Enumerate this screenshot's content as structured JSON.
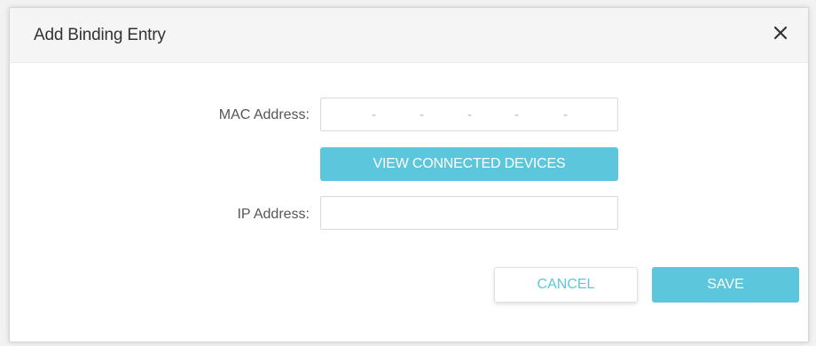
{
  "dialog": {
    "title": "Add Binding Entry",
    "close_icon": "close-icon"
  },
  "form": {
    "mac_label": "MAC Address:",
    "mac_separators": [
      "-",
      "-",
      "-",
      "-",
      "-"
    ],
    "view_devices_label": "VIEW CONNECTED DEVICES",
    "ip_label": "IP Address:",
    "ip_value": "",
    "ip_placeholder": ""
  },
  "actions": {
    "cancel_label": "CANCEL",
    "save_label": "SAVE"
  },
  "colors": {
    "accent": "#5bc6dc",
    "header_bg": "#f5f5f5",
    "label_text": "#555555"
  }
}
